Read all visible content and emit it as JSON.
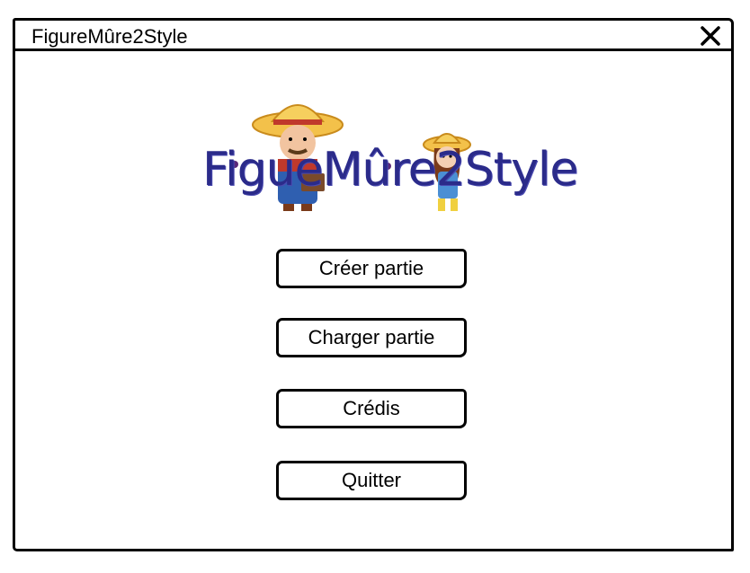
{
  "window": {
    "title": "FigureMûre2Style"
  },
  "logo": {
    "text": "FigueMûre2Style",
    "color": "#2b2b8a"
  },
  "menu": {
    "buttons": [
      {
        "label": "Créer partie"
      },
      {
        "label": "Charger partie"
      },
      {
        "label": "Crédis"
      },
      {
        "label": "Quitter"
      }
    ]
  },
  "icons": {
    "close": "close-icon"
  }
}
